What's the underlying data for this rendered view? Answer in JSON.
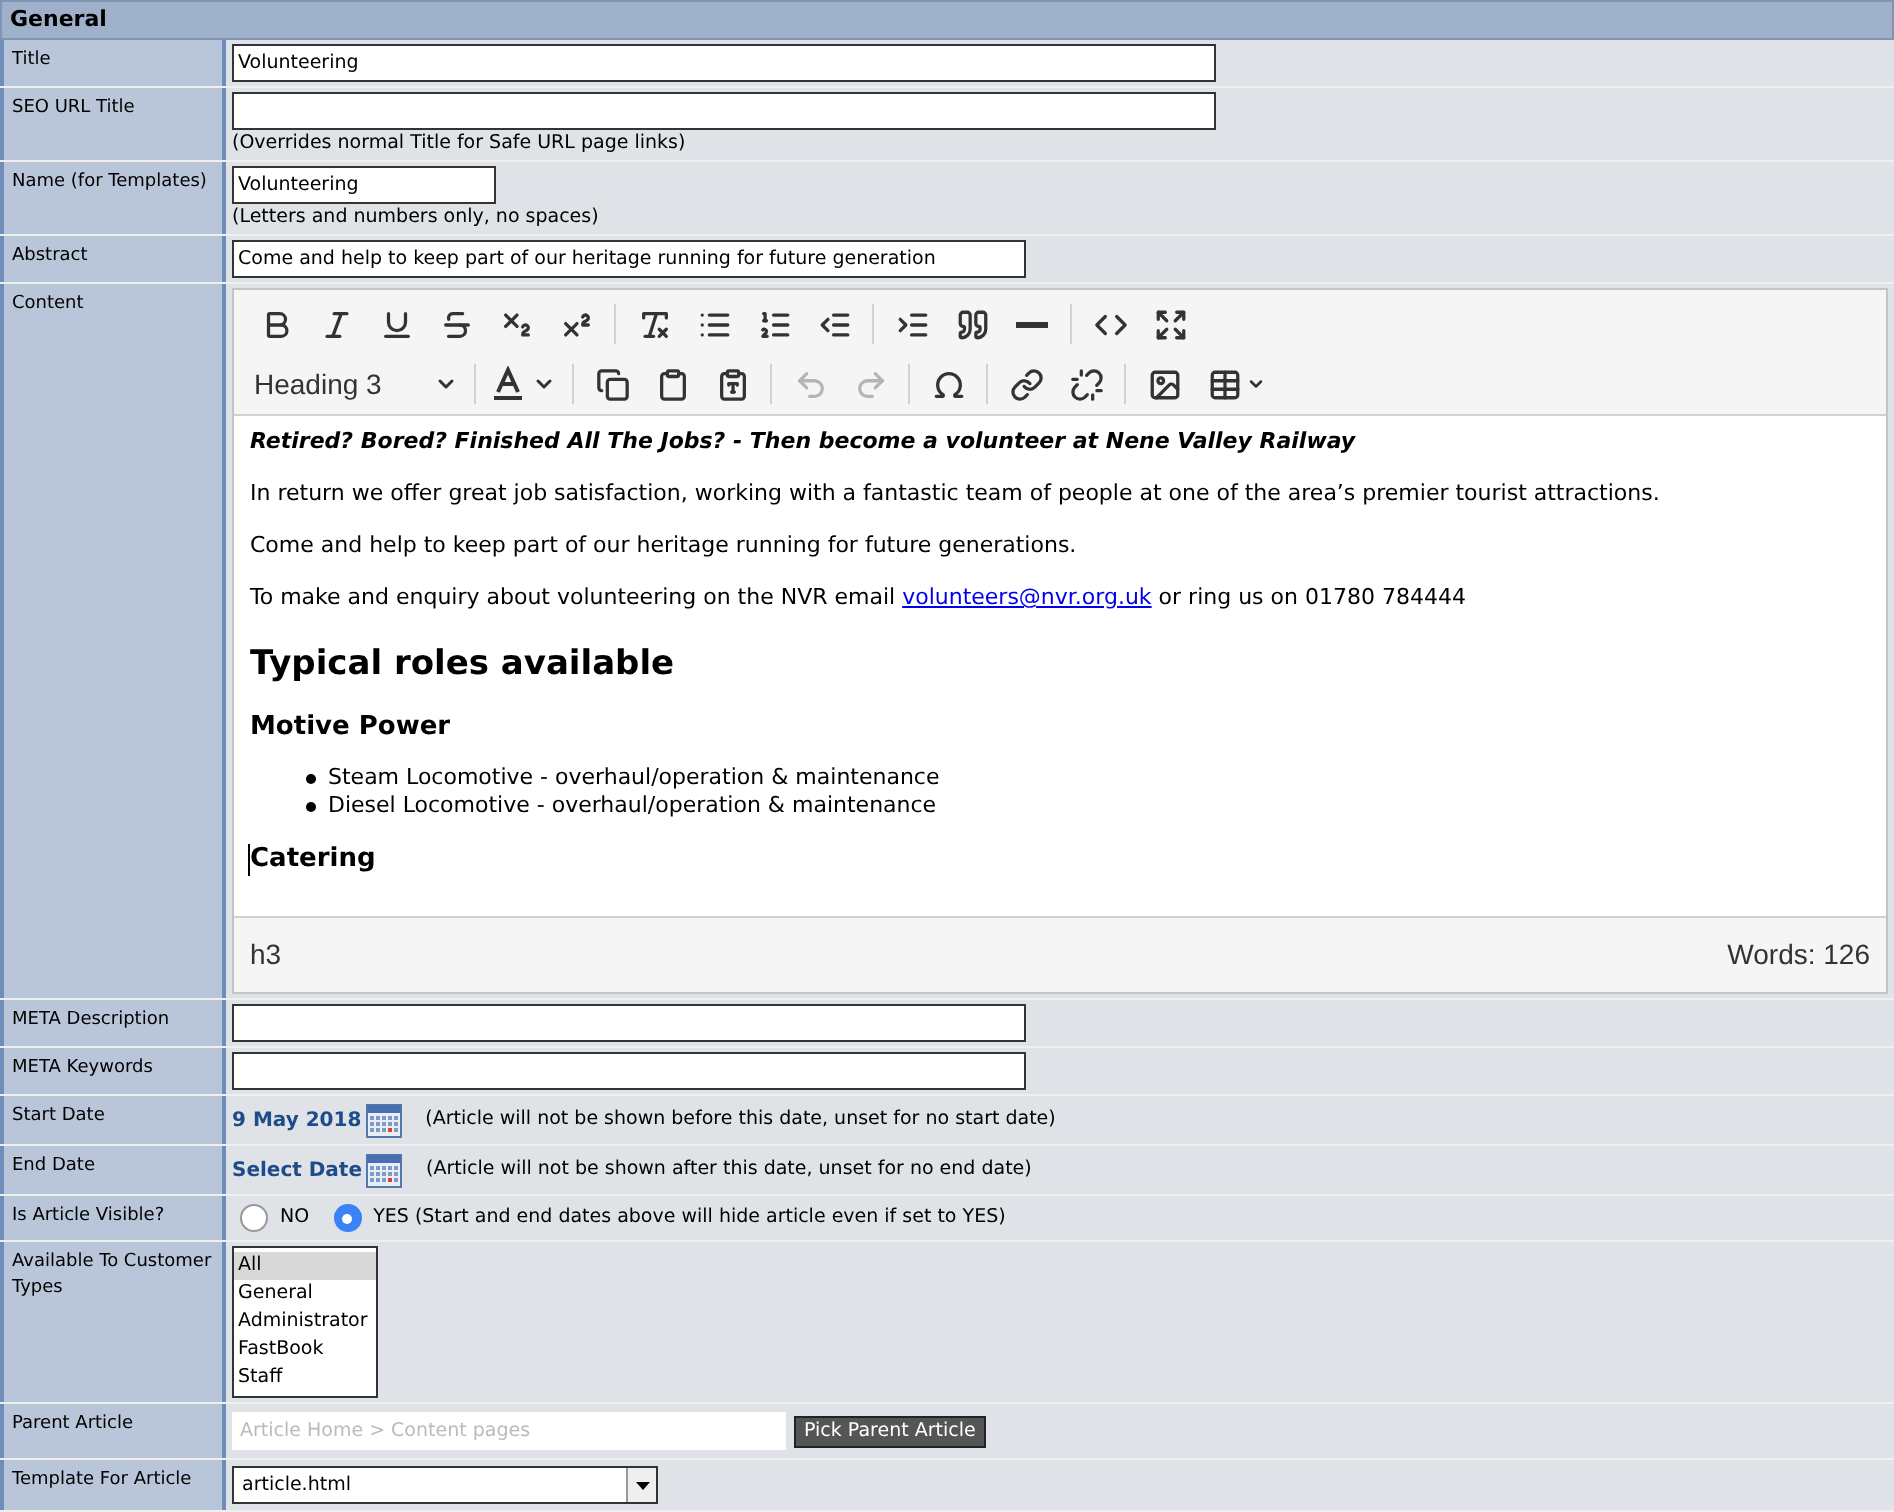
{
  "section": {
    "title": "General"
  },
  "fields": [
    {
      "kind": "text",
      "label": "Title",
      "value": "Volunteering"
    },
    {
      "kind": "text",
      "label": "SEO URL Title",
      "hint": "(Overrides normal Title for Safe URL page links)"
    },
    {
      "kind": "text",
      "label": "Name (for Templates)",
      "value": "Volunteering",
      "hint": "(Letters and numbers only, no spaces)"
    },
    {
      "kind": "text",
      "label": "Abstract",
      "value": "Come and help to keep part of our heritage running for future generation"
    },
    {
      "kind": "editor",
      "label": "Content"
    },
    {
      "kind": "text",
      "label": "META Description"
    },
    {
      "kind": "text",
      "label": "META Keywords"
    },
    {
      "kind": "date",
      "label": "Start Date",
      "value": "9 May 2018",
      "note": "(Article will not be shown before this date, unset for no start date)"
    },
    {
      "kind": "date",
      "label": "End Date",
      "value": "Select Date",
      "note": "(Article will not be shown after this date, unset for no end date)"
    },
    {
      "kind": "radio",
      "label": "Is Article Visible?",
      "options": [
        {
          "label": "NO",
          "selected": false
        },
        {
          "label": "YES (Start and end dates above will hide article even if set to YES)",
          "selected": true
        }
      ]
    },
    {
      "kind": "listbox",
      "label": "Available To Customer Types",
      "options": [
        {
          "label": "All",
          "selected": true
        },
        {
          "label": "General",
          "selected": false
        },
        {
          "label": "Administrator",
          "selected": false
        },
        {
          "label": "FastBook",
          "selected": false
        },
        {
          "label": "Staff",
          "selected": false
        }
      ]
    },
    {
      "kind": "picker",
      "label": "Parent Article",
      "placeholder": "Article Home > Content pages",
      "button": "Pick Parent Article"
    },
    {
      "kind": "select",
      "label": "Template For Article",
      "value": "article.html"
    }
  ],
  "editor": {
    "toolbar": [
      [
        {
          "disabled": false
        },
        {
          "disabled": false
        },
        {
          "disabled": false
        },
        {
          "disabled": false
        },
        {
          "disabled": false
        },
        {
          "disabled": false
        },
        {
          "disabled": false
        },
        {
          "disabled": false
        },
        {
          "disabled": false
        },
        {
          "disabled": false
        },
        {
          "disabled": false
        },
        {
          "disabled": false
        },
        {
          "disabled": false
        },
        {
          "disabled": false
        },
        {
          "disabled": false
        }
      ],
      [
        {
          "disabled": false
        },
        {
          "disabled": false
        },
        {
          "disabled": false
        },
        {
          "disabled": true
        },
        {
          "disabled": true
        },
        {
          "disabled": false
        },
        {
          "disabled": false
        },
        {
          "disabled": false
        },
        {
          "disabled": false
        },
        {
          "disabled": false
        }
      ]
    ],
    "format": "Heading 3",
    "content": [
      {
        "kind": "lead",
        "text": "Retired? Bored? Finished All The Jobs? - Then become a volunteer at Nene Valley Railway"
      },
      {
        "kind": "p",
        "text": "In return we offer great job satisfaction, working with a fantastic team of people at one of the area’s premier tourist attractions."
      },
      {
        "kind": "p",
        "text": "Come and help to keep part of our heritage running for future generations."
      },
      {
        "kind": "p",
        "text": "To make and enquiry about volunteering on the NVR email ",
        "link": "volunteers@nvr.org.uk",
        "after": " or ring us on 01780 784444"
      },
      {
        "kind": "h2",
        "text": "Typical roles available"
      },
      {
        "kind": "h3",
        "text": "Motive Power",
        "caret": false
      },
      {
        "kind": "ul",
        "items": [
          "Steam Locomotive - overhaul/operation & maintenance",
          "Diesel Locomotive - overhaul/operation & maintenance"
        ]
      },
      {
        "kind": "h3",
        "text": "Catering",
        "caret": true
      }
    ],
    "path": "h3",
    "word_count": "Words: 126"
  }
}
